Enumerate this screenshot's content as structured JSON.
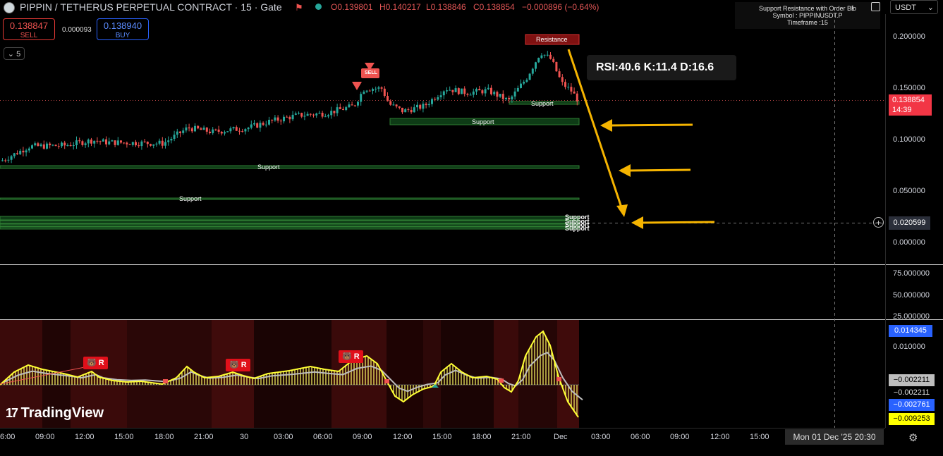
{
  "header": {
    "title": "PIPPIN / TETHERUS PERPETUAL CONTRACT · 15 · Gate",
    "open": "O0.139801",
    "high": "H0.140217",
    "low": "L0.138846",
    "close": "C0.138854",
    "change": "−0.000896 (−0.64%)"
  },
  "trade": {
    "sell_price": "0.138847",
    "sell_label": "SELL",
    "spread": "0.000093",
    "buy_price": "0.138940",
    "buy_label": "BUY"
  },
  "interval_toggle": "5",
  "currency": "USDT",
  "info_panel": {
    "line1": "Support Resistance with Order Blo",
    "line2": "Symbol : PIPPINUSDT.P",
    "line3": "Timeframe :15"
  },
  "rsi_box": "RSI:40.6  K:11.4 D:16.6",
  "price_axis": [
    "0.200000",
    "0.150000",
    "0.100000",
    "0.050000",
    "0.000000"
  ],
  "current_price": "0.138854",
  "countdown": "14:39",
  "crosshair_price": "0.020599",
  "rsi_axis": [
    "75.000000",
    "50.000000",
    "25.000000"
  ],
  "osc_axis": {
    "top": "0.014345",
    "tick": "0.010000",
    "v1": "−0.002211",
    "v2": "−0.002211",
    "v3": "−0.002761",
    "v4": "−0.009253"
  },
  "time_axis": [
    "6:00",
    "09:00",
    "12:00",
    "15:00",
    "18:00",
    "21:00",
    "30",
    "03:00",
    "06:00",
    "09:00",
    "12:00",
    "15:00",
    "18:00",
    "21:00",
    "Dec",
    "03:00",
    "06:00",
    "09:00",
    "12:00",
    "15:00"
  ],
  "crosshair_date": "Mon 01 Dec '25   20:30",
  "labels": {
    "resistance": "Resistance",
    "support": "Support",
    "sell_signal": "SELL",
    "reversal": "R"
  },
  "brand": "TradingView",
  "colors": {
    "up": "#26a69a",
    "down": "#ef5350",
    "support_zone": "#2e7d32",
    "resistance_zone": "#c62828",
    "arrow": "#f5b400",
    "osc_line": "#ffff33"
  }
}
